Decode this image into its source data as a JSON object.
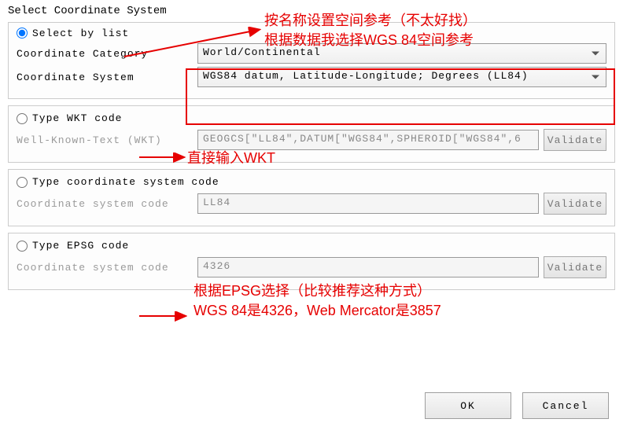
{
  "title": "Select Coordinate System",
  "sections": {
    "byList": {
      "radioLabel": "Select by list",
      "categoryLabel": "Coordinate Category",
      "categoryValue": "World/Continental",
      "systemLabel": "Coordinate System",
      "systemValue": "WGS84 datum, Latitude-Longitude; Degrees (LL84)"
    },
    "wkt": {
      "radioLabel": "Type WKT code",
      "fieldLabel": "Well-Known-Text (WKT)",
      "fieldValue": "GEOGCS[\"LL84\",DATUM[\"WGS84\",SPHEROID[\"WGS84\",6",
      "validateLabel": "Validate"
    },
    "csCode": {
      "radioLabel": "Type coordinate system code",
      "fieldLabel": "Coordinate system code",
      "fieldValue": "LL84",
      "validateLabel": "Validate"
    },
    "epsg": {
      "radioLabel": "Type EPSG code",
      "fieldLabel": "Coordinate system code",
      "fieldValue": "4326",
      "validateLabel": "Validate"
    }
  },
  "buttons": {
    "ok": "OK",
    "cancel": "Cancel"
  },
  "annotations": {
    "a1_line1": "按名称设置空间参考（不太好找）",
    "a1_line2": "根据数据我选择WGS 84空间参考",
    "a2": "直接输入WKT",
    "a3_line1": "根据EPSG选择（比较推荐这种方式）",
    "a3_line2": "WGS 84是4326，Web Mercator是3857"
  }
}
